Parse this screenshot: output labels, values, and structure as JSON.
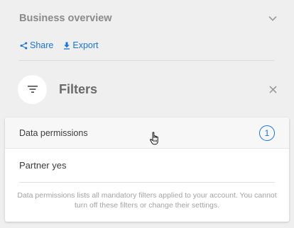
{
  "header": {
    "title": "Business overview",
    "chevron_icon": "chevron-down-icon"
  },
  "actions": {
    "share_label": "Share",
    "share_icon": "share-icon",
    "export_label": "Export",
    "export_icon": "download-icon"
  },
  "filters": {
    "title": "Filters",
    "filter_icon": "filter-icon",
    "close_icon": "close-icon"
  },
  "data_permissions": {
    "label": "Data permissions",
    "count": "1",
    "items": [
      "Partner yes"
    ],
    "note": "Data permissions lists all mandatory filters applied to your account. You cannot turn off these filters or change their settings."
  },
  "colors": {
    "accent": "#1a73d4",
    "background": "#efefef",
    "card": "#ffffff"
  }
}
